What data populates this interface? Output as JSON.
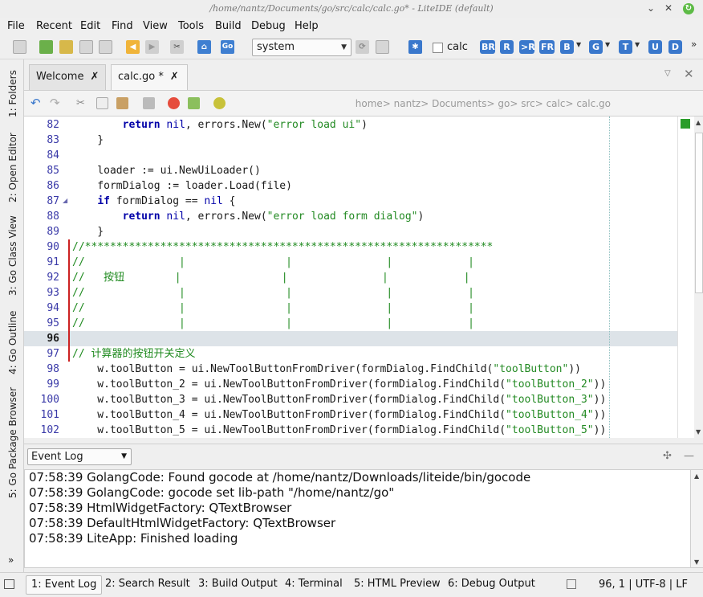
{
  "window": {
    "title": "/home/nantz/Documents/go/src/calc/calc.go* - LiteIDE (default)",
    "min": "⌄",
    "max": "✕"
  },
  "menu": [
    "File",
    "Recent",
    "Edit",
    "Find",
    "View",
    "Tools",
    "Build",
    "Debug",
    "Help"
  ],
  "toolbar": {
    "env_select": "system",
    "checkbox_label": "calc",
    "go_label": "Go",
    "buttons": [
      "BR",
      "R",
      ">R",
      "FR",
      "B",
      "G",
      "T",
      "U",
      "D"
    ],
    "overflow": "»"
  },
  "side_tabs": [
    "1: Folders",
    "2: Open Editor",
    "3: Go Class View",
    "4: Go Outline",
    "5: Go Package Browser"
  ],
  "side_more": "»",
  "editor_tabs": [
    {
      "label": "Welcome",
      "close": "✗"
    },
    {
      "label": "calc.go *",
      "close": "✗"
    }
  ],
  "breadcrumb": "home> nantz> Documents> go> src> calc> calc.go",
  "code_lines": [
    {
      "n": "82",
      "segs": [
        [
          "",
          "        "
        ],
        [
          "kw",
          "return"
        ],
        [
          "",
          " "
        ],
        [
          "nl",
          "nil"
        ],
        [
          "",
          ", errors.New("
        ],
        [
          "str",
          "\"error load ui\""
        ],
        [
          "",
          ")"
        ]
      ]
    },
    {
      "n": "83",
      "segs": [
        [
          "",
          "    }"
        ]
      ]
    },
    {
      "n": "84",
      "segs": [
        [
          "",
          ""
        ]
      ]
    },
    {
      "n": "85",
      "segs": [
        [
          "",
          "    loader := ui.NewUiLoader()"
        ]
      ]
    },
    {
      "n": "86",
      "segs": [
        [
          "",
          "    formDialog := loader.Load(file)"
        ]
      ]
    },
    {
      "n": "87",
      "segs": [
        [
          "",
          "    "
        ],
        [
          "kw",
          "if"
        ],
        [
          "",
          " formDialog == "
        ],
        [
          "nl",
          "nil"
        ],
        [
          "",
          " {"
        ]
      ]
    },
    {
      "n": "88",
      "segs": [
        [
          "",
          "        "
        ],
        [
          "kw",
          "return"
        ],
        [
          "",
          " "
        ],
        [
          "nl",
          "nil"
        ],
        [
          "",
          ", errors.New("
        ],
        [
          "str",
          "\"error load form dialog\""
        ],
        [
          "",
          ")"
        ]
      ]
    },
    {
      "n": "89",
      "segs": [
        [
          "",
          "    }"
        ]
      ]
    },
    {
      "n": "90",
      "segs": [
        [
          "com",
          "//*****************************************************************"
        ]
      ]
    },
    {
      "n": "91",
      "segs": [
        [
          "com",
          "//               |                |               |            |"
        ]
      ]
    },
    {
      "n": "92",
      "segs": [
        [
          "com",
          "//   按钮        |                |               |            |"
        ]
      ]
    },
    {
      "n": "93",
      "segs": [
        [
          "com",
          "//               |                |               |            |"
        ]
      ]
    },
    {
      "n": "94",
      "segs": [
        [
          "com",
          "//               |                |               |            |"
        ]
      ]
    },
    {
      "n": "95",
      "segs": [
        [
          "com",
          "//               |                |               |            |"
        ]
      ]
    },
    {
      "n": "96",
      "segs": [
        [
          "",
          ""
        ]
      ]
    },
    {
      "n": "97",
      "segs": [
        [
          "com",
          "// 计算器的按钮开关定义"
        ]
      ]
    },
    {
      "n": "98",
      "segs": [
        [
          "",
          "    w.toolButton = ui.NewToolButtonFromDriver(formDialog.FindChild("
        ],
        [
          "str",
          "\"toolButton\""
        ],
        [
          "",
          "))"
        ]
      ]
    },
    {
      "n": "99",
      "segs": [
        [
          "",
          "    w.toolButton_2 = ui.NewToolButtonFromDriver(formDialog.FindChild("
        ],
        [
          "str",
          "\"toolButton_2\""
        ],
        [
          "",
          "))"
        ]
      ]
    },
    {
      "n": "100",
      "segs": [
        [
          "",
          "    w.toolButton_3 = ui.NewToolButtonFromDriver(formDialog.FindChild("
        ],
        [
          "str",
          "\"toolButton_3\""
        ],
        [
          "",
          "))"
        ]
      ]
    },
    {
      "n": "101",
      "segs": [
        [
          "",
          "    w.toolButton_4 = ui.NewToolButtonFromDriver(formDialog.FindChild("
        ],
        [
          "str",
          "\"toolButton_4\""
        ],
        [
          "",
          "))"
        ]
      ]
    },
    {
      "n": "102",
      "segs": [
        [
          "",
          "    w.toolButton_5 = ui.NewToolButtonFromDriver(formDialog.FindChild("
        ],
        [
          "str",
          "\"toolButton_5\""
        ],
        [
          "",
          "))"
        ]
      ]
    }
  ],
  "log": {
    "select": "Event Log",
    "lines": [
      "07:58:39 GolangCode: Found gocode at /home/nantz/Downloads/liteide/bin/gocode",
      "07:58:39 GolangCode: gocode set lib-path \"/home/nantz/go\"",
      "07:58:39 HtmlWidgetFactory: QTextBrowser",
      "07:58:39 DefaultHtmlWidgetFactory: QTextBrowser",
      "07:58:39 LiteApp: Finished loading"
    ]
  },
  "bottom_tabs": [
    "1: Event Log",
    "2: Search Result",
    "3: Build Output",
    "4: Terminal",
    "5: HTML Preview",
    "6: Debug Output"
  ],
  "cursor_status": "96,  1 | UTF-8 | LF",
  "colors": {
    "keyword": "#0000a8",
    "string": "#238a23",
    "comment": "#1f8a1f",
    "line_number": "#3a3aa8",
    "accent": "#3a78cc"
  }
}
